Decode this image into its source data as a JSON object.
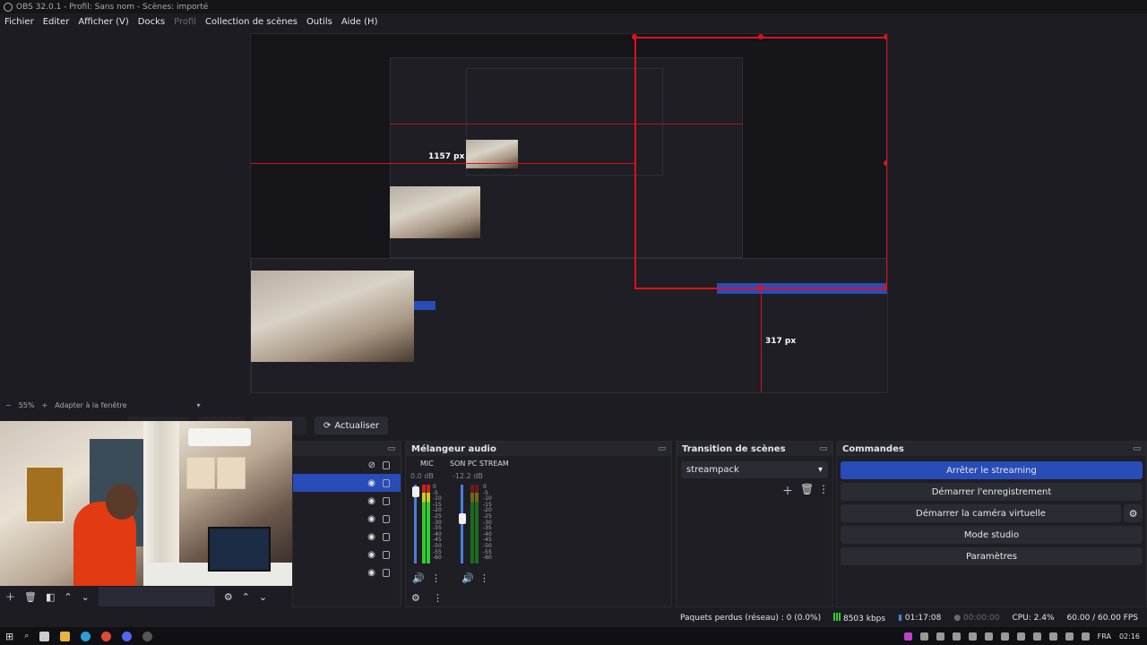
{
  "window": {
    "title": "OBS 32.0.1 - Profil: Sans nom - Scènes: importé"
  },
  "menu": [
    {
      "label": "Fichier",
      "dim": false
    },
    {
      "label": "Editer",
      "dim": false
    },
    {
      "label": "Afficher (V)",
      "dim": false
    },
    {
      "label": "Docks",
      "dim": false
    },
    {
      "label": "Profil",
      "dim": true
    },
    {
      "label": "Collection de scènes",
      "dim": false
    },
    {
      "label": "Outils",
      "dim": false
    },
    {
      "label": "Aide (H)",
      "dim": false
    }
  ],
  "preview": {
    "labels": {
      "width_label": "1157 px",
      "height_label": "317 px"
    }
  },
  "zoom": {
    "minus": "−",
    "value": "55%",
    "plus": "+",
    "fit": "Adapter à la fenêtre"
  },
  "toolbar": {
    "refresh": "Actualiser"
  },
  "mixer": {
    "title": "Mélangeur audio",
    "channels": [
      {
        "name": "MIC",
        "db": "0.0 dB",
        "level": 0.95
      },
      {
        "name": "SON PC STREAM",
        "db": "-12.2 dB",
        "level": 0.6
      }
    ],
    "ticks": [
      "0",
      "-5",
      "-10",
      "-15",
      "-20",
      "-25",
      "-30",
      "-35",
      "-40",
      "-45",
      "-50",
      "-55",
      "-60"
    ]
  },
  "transitions": {
    "title": "Transition de scènes",
    "selected": "streampack"
  },
  "commands": {
    "title": "Commandes",
    "stop_stream": "Arrêter le streaming",
    "start_record": "Démarrer l'enregistrement",
    "start_vcam": "Démarrer la caméra virtuelle",
    "studio_mode": "Mode studio",
    "settings": "Paramètres"
  },
  "status": {
    "dropped": "Paquets perdus (réseau) : 0 (0.0%)",
    "bitrate": "8503 kbps",
    "stream_time": "01:17:08",
    "rec_time": "00:00:00",
    "cpu": "CPU: 2.4%",
    "fps": "60.00 / 60.00 FPS"
  },
  "taskbar": {
    "lang": "FRA",
    "clock": "02:16"
  },
  "colors": {
    "accent": "#284cb8",
    "guide": "#e0101a",
    "bg": "#1c1c22"
  }
}
